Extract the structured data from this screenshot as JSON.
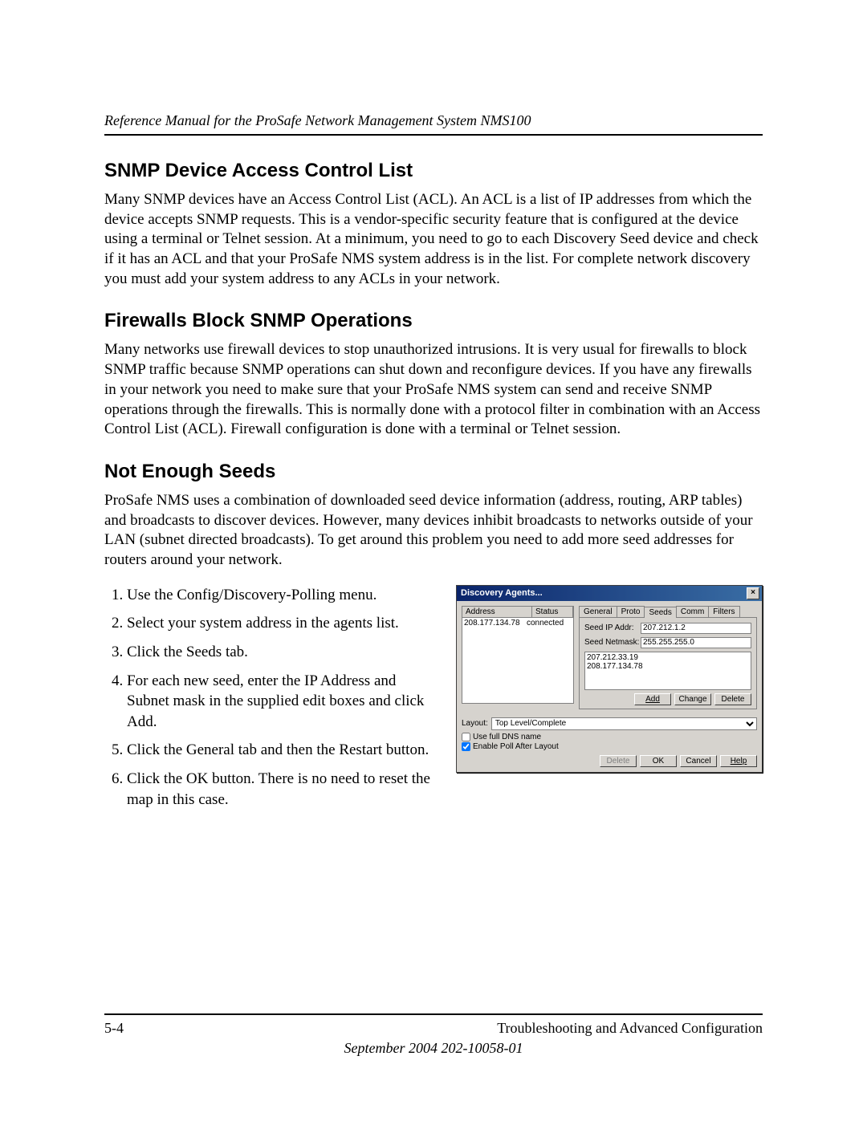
{
  "header": {
    "running_title": "Reference Manual for the ProSafe Network Management System NMS100"
  },
  "sections": [
    {
      "heading": "SNMP Device Access Control List",
      "paragraph": "Many SNMP devices have an Access Control List (ACL). An ACL is a list of IP addresses from which the device accepts SNMP requests. This is a vendor-specific security feature that is configured at the device using a terminal or Telnet session. At a minimum, you need to go to each Discovery Seed device and check if it has an ACL and that your ProSafe NMS system address is in the list. For complete network discovery you must add your system address to any ACLs in your network."
    },
    {
      "heading": "Firewalls Block SNMP Operations",
      "paragraph": "Many networks use firewall devices to stop unauthorized intrusions. It is very usual for firewalls to block SNMP traffic because SNMP operations can shut down and reconfigure devices. If you have any firewalls in your network you need to make sure that your ProSafe NMS system can send and receive SNMP operations through the firewalls. This is normally done with a protocol filter in combination with an Access Control List (ACL). Firewall configuration is done with a terminal or Telnet session."
    },
    {
      "heading": "Not Enough Seeds",
      "paragraph": "ProSafe NMS uses a combination of downloaded seed device information (address, routing, ARP tables) and broadcasts to discover devices. However, many devices inhibit broadcasts to networks outside of your LAN (subnet directed broadcasts). To get around this problem you need to add more seed addresses for routers around your network."
    }
  ],
  "steps": [
    "Use the Config/Discovery-Polling menu.",
    "Select your system address in the agents list.",
    "Click the Seeds tab.",
    "For each new seed, enter the IP Address and Subnet mask in the supplied edit boxes and click Add.",
    "Click the General tab and then the Restart button.",
    "Click the OK button. There is no need to reset the map in this case."
  ],
  "dialog": {
    "title": "Discovery Agents...",
    "agents": {
      "col_address": "Address",
      "col_status": "Status",
      "rows": [
        {
          "address": "208.177.134.78",
          "status": "connected"
        }
      ]
    },
    "tabs": [
      "General",
      "Proto",
      "Seeds",
      "Comm",
      "Filters"
    ],
    "active_tab": "Seeds",
    "seed_ip_label": "Seed IP Addr:",
    "seed_ip_value": "207.212.1.2",
    "seed_netmask_label": "Seed Netmask:",
    "seed_netmask_value": "255.255.255.0",
    "seed_list": [
      "207.212.33.19",
      "208.177.134.78"
    ],
    "buttons_tab": {
      "add": "Add",
      "change": "Change",
      "delete": "Delete"
    },
    "layout_label": "Layout:",
    "layout_value": "Top Level/Complete",
    "chk_full_dns": "Use full DNS name",
    "chk_poll_after": "Enable Poll After Layout",
    "buttons_main": {
      "delete": "Delete",
      "ok": "OK",
      "cancel": "Cancel",
      "help": "Help"
    }
  },
  "footer": {
    "page": "5-4",
    "chapter": "Troubleshooting and Advanced Configuration",
    "dateline": "September 2004 202-10058-01"
  }
}
